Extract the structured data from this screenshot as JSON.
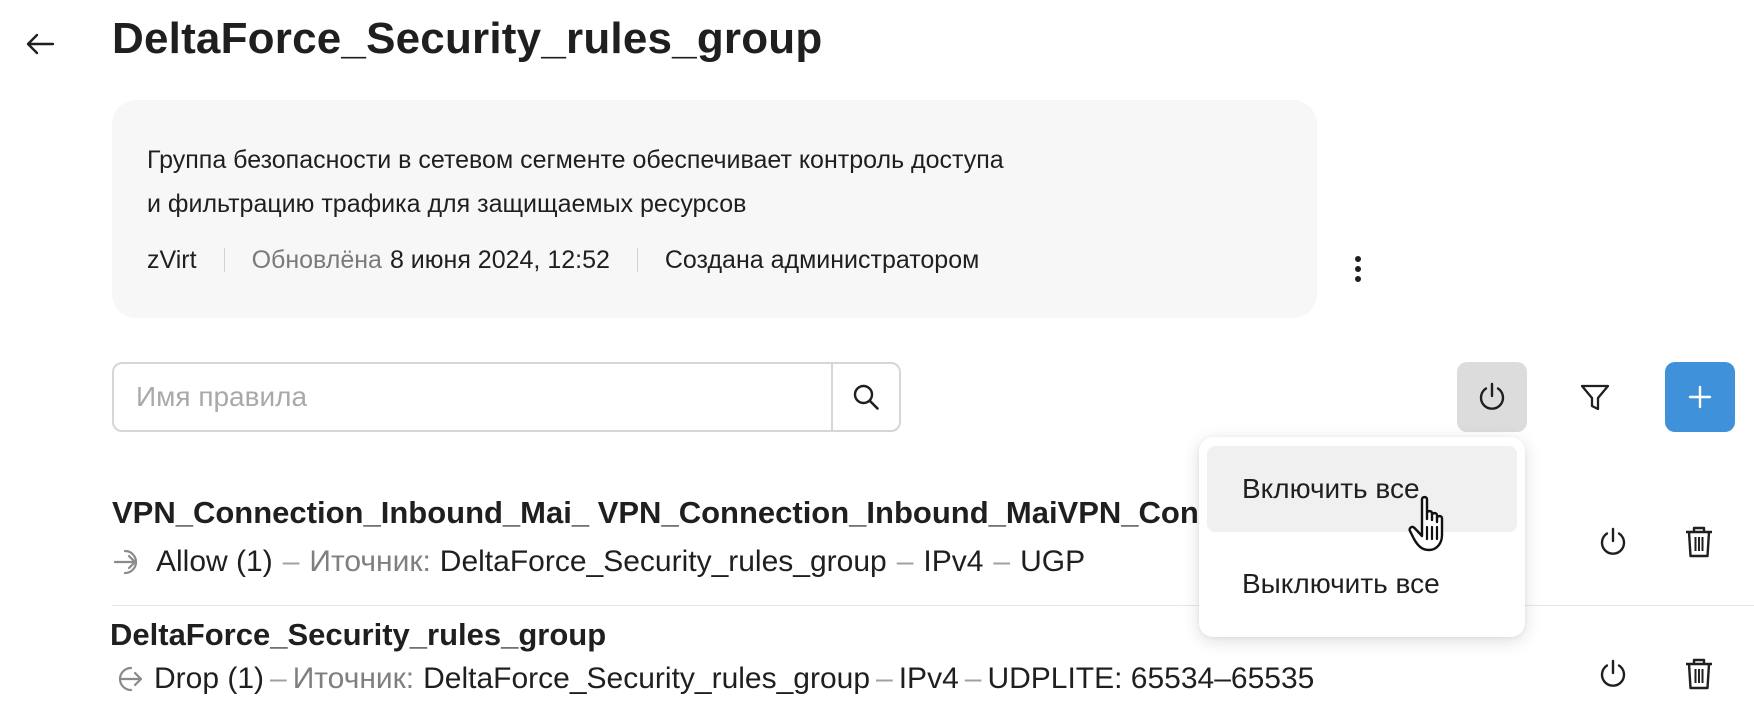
{
  "header": {
    "title": "DeltaForce_Security_rules_group",
    "back_icon": "arrow-left-icon"
  },
  "info": {
    "description_line1": "Группа безопасности в сетевом сегменте обеспечивает контроль доступа",
    "description_line2": "и фильтрацию трафика для защищаемых ресурсов",
    "platform": "zVirt",
    "updated_label": "Обновлёна",
    "updated_value": "8 июня 2024, 12:52",
    "created_by": "Создана администратором"
  },
  "search": {
    "placeholder": "Имя правила",
    "value": ""
  },
  "toolbar": {
    "power_icon": "power-icon",
    "filter_icon": "filter-icon",
    "add_icon": "plus-icon",
    "add_color": "#3f92d9"
  },
  "dropdown": {
    "enable_all": "Включить все",
    "disable_all": "Выключить все"
  },
  "rules": [
    {
      "title": "VPN_Connection_Inbound_Mai_ VPN_Connection_Inbound_MaiVPN_Connection",
      "direction_icon": "inbound-arrow-icon",
      "action": "Allow (1)",
      "source_label": "Иточник:",
      "source": "DeltaForce_Security_rules_group",
      "ip": "IPv4",
      "protocol": "UGP"
    },
    {
      "title": "DeltaForce_Security_rules_group",
      "direction_icon": "outbound-arrow-icon",
      "action": "Drop (1)",
      "source_label": "Иточник:",
      "source": "DeltaForce_Security_rules_group",
      "ip": "IPv4",
      "protocol": "UDPLITE: 65534–65535"
    }
  ],
  "separators": {
    "dash": "–"
  }
}
